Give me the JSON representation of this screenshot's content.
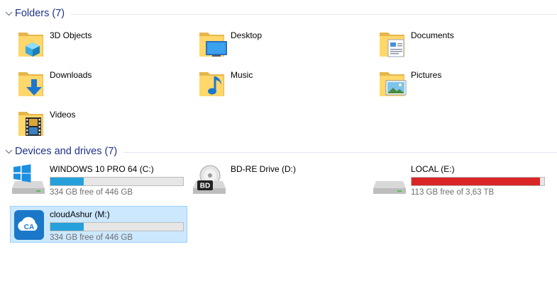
{
  "folders_group": {
    "title": "Folders (7)",
    "items": [
      {
        "label": "3D Objects",
        "icon": "3d-objects-folder-icon"
      },
      {
        "label": "Desktop",
        "icon": "desktop-folder-icon"
      },
      {
        "label": "Documents",
        "icon": "documents-folder-icon"
      },
      {
        "label": "Downloads",
        "icon": "downloads-folder-icon"
      },
      {
        "label": "Music",
        "icon": "music-folder-icon"
      },
      {
        "label": "Pictures",
        "icon": "pictures-folder-icon"
      },
      {
        "label": "Videos",
        "icon": "videos-folder-icon"
      }
    ]
  },
  "drives_group": {
    "title": "Devices and drives (7)",
    "items": [
      {
        "name": "WINDOWS 10 PRO 64 (C:)",
        "free": "334 GB free of 446 GB",
        "used_fraction": 0.25,
        "icon": "windows-drive-icon"
      },
      {
        "name": "BD-RE Drive (D:)",
        "icon": "bd-drive-icon"
      },
      {
        "name": "LOCAL (E:)",
        "free": "113 GB free of 3,63 TB",
        "used_fraction": 0.97,
        "icon": "hard-drive-icon"
      },
      {
        "name": "cloudAshur (M:)",
        "free": "334 GB free of 446 GB",
        "used_fraction": 0.25,
        "icon": "cloudashur-drive-icon",
        "selected": true
      }
    ]
  },
  "colors": {
    "header_text": "#1e3287",
    "bar_fill": "#26a0da",
    "bar_full": "#da2626",
    "selection": "#cce8ff"
  },
  "labels": {
    "bd_badge": "BD",
    "ca_badge": "CA"
  }
}
